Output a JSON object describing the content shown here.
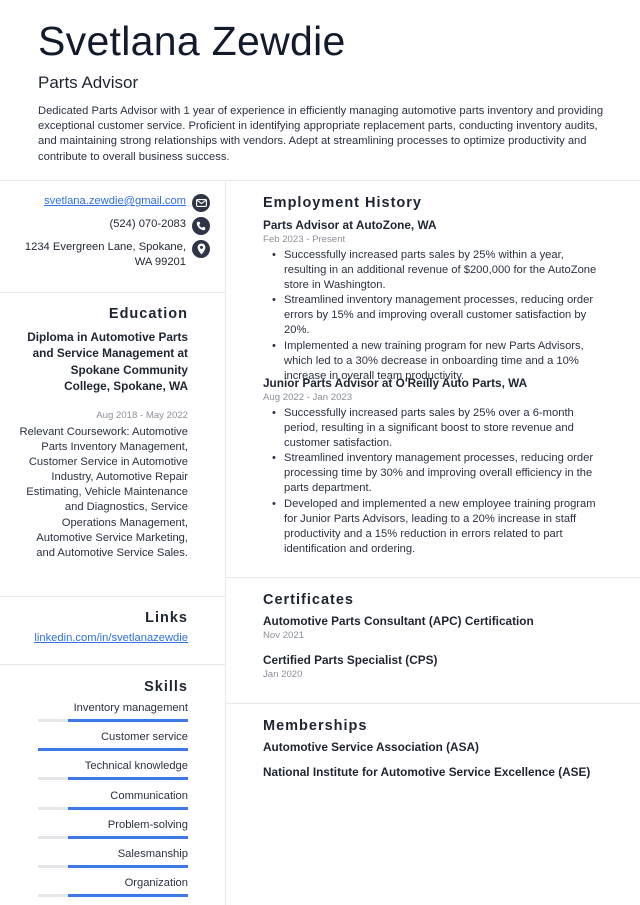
{
  "header": {
    "name": "Svetlana Zewdie",
    "title": "Parts Advisor",
    "summary": "Dedicated Parts Advisor with 1 year of experience in efficiently managing automotive parts inventory and providing exceptional customer service. Proficient in identifying appropriate replacement parts, conducting inventory audits, and maintaining strong relationships with vendors. Adept at streamlining processes to optimize productivity and contribute to overall business success."
  },
  "contact": {
    "email": "svetlana.zewdie@gmail.com",
    "phone": "(524) 070-2083",
    "address_line1": "1234 Evergreen Lane, Spokane,",
    "address_line2": "WA 99201",
    "icons": [
      "envelope-icon",
      "phone-icon",
      "location-pin-icon"
    ]
  },
  "education": {
    "title": "Education",
    "degree": "Diploma in Automotive Parts and Service Management at Spokane Community College, Spokane, WA",
    "dates": "Aug 2018 - May 2022",
    "description": "Relevant Coursework: Automotive Parts Inventory Management, Customer Service in Automotive Industry, Automotive Repair Estimating, Vehicle Maintenance and Diagnostics, Service Operations Management, Automotive Service Marketing, and Automotive Service Sales."
  },
  "links": {
    "title": "Links",
    "items": [
      "linkedin.com/in/svetlanazewdie"
    ]
  },
  "skills": {
    "title": "Skills",
    "accent_color": "#3b7ae6",
    "items": [
      {
        "name": "Inventory management",
        "level": 0.8
      },
      {
        "name": "Customer service",
        "level": 1.0
      },
      {
        "name": "Technical knowledge",
        "level": 0.8
      },
      {
        "name": "Communication",
        "level": 0.8
      },
      {
        "name": "Problem-solving",
        "level": 0.8
      },
      {
        "name": "Salesmanship",
        "level": 0.8
      },
      {
        "name": "Organization",
        "level": 0.8
      }
    ]
  },
  "employment": {
    "title": "Employment History",
    "jobs": [
      {
        "heading": "Parts Advisor at AutoZone, WA",
        "dates": "Feb 2023 - Present",
        "bullets": [
          "Successfully increased parts sales by 25% within a year, resulting in an additional revenue of $200,000 for the AutoZone store in Washington.",
          "Streamlined inventory management processes, reducing order errors by 15% and improving overall customer satisfaction by 20%.",
          "Implemented a new training program for new Parts Advisors, which led to a 30% decrease in onboarding time and a 10% increase in overall team productivity."
        ]
      },
      {
        "heading": "Junior Parts Advisor at O'Reilly Auto Parts, WA",
        "dates": "Aug 2022 - Jan 2023",
        "bullets": [
          "Successfully increased parts sales by 25% over a 6-month period, resulting in a significant boost to store revenue and customer satisfaction.",
          "Streamlined inventory management processes, reducing order processing time by 30% and improving overall efficiency in the parts department.",
          "Developed and implemented a new employee training program for Junior Parts Advisors, leading to a 20% increase in staff productivity and a 15% reduction in errors related to part identification and ordering."
        ]
      }
    ]
  },
  "certificates": {
    "title": "Certificates",
    "items": [
      {
        "name": "Automotive Parts Consultant (APC) Certification",
        "date": "Nov 2021"
      },
      {
        "name": "Certified Parts Specialist (CPS)",
        "date": "Jan 2020"
      }
    ]
  },
  "memberships": {
    "title": "Memberships",
    "items": [
      "Automotive Service Association (ASA)",
      "National Institute for Automotive Service Excellence (ASE)"
    ]
  }
}
